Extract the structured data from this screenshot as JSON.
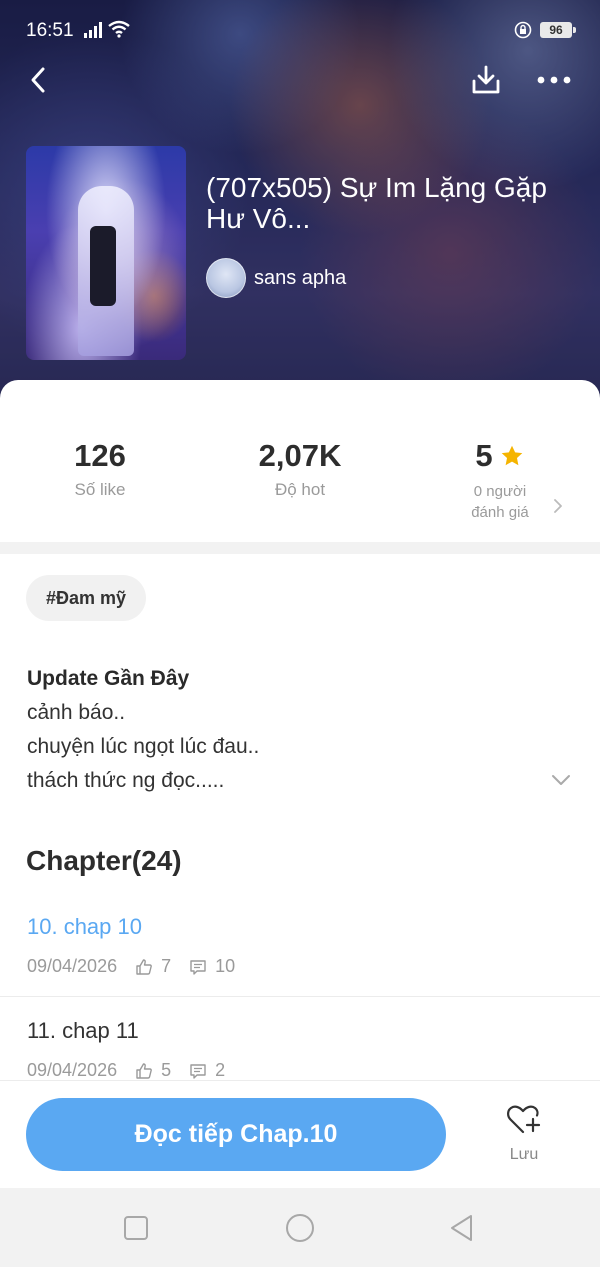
{
  "status": {
    "time": "16:51",
    "battery": "96"
  },
  "story": {
    "title": "(707x505) Sự Im Lặng Gặp Hư Vô...",
    "author": "sans apha"
  },
  "stats": {
    "likes": {
      "value": "126",
      "label": "Số like"
    },
    "hot": {
      "value": "2,07K",
      "label": "Độ hot"
    },
    "rating": {
      "value": "5",
      "label_line1": "0 người",
      "label_line2": "đánh giá"
    }
  },
  "tag": "#Đam mỹ",
  "description": {
    "title": "Update Gần Đây",
    "lines": [
      "cảnh báo..",
      "chuyện lúc ngọt lúc đau..",
      "thách thức ng đọc....."
    ]
  },
  "chapter_heading": "Chapter(24)",
  "chapters": [
    {
      "title": "10. chap 10",
      "date": "09/04/2026",
      "likes": "7",
      "comments": "10",
      "active": true
    },
    {
      "title": "11. chap 11",
      "date": "09/04/2026",
      "likes": "5",
      "comments": "2",
      "active": false
    }
  ],
  "actions": {
    "continue_label": "Đọc tiếp Chap.10",
    "save_label": "Lưu"
  },
  "colors": {
    "accent": "#5aa8f2",
    "star": "#f5b400",
    "active_chapter": "#5aa8f2"
  }
}
